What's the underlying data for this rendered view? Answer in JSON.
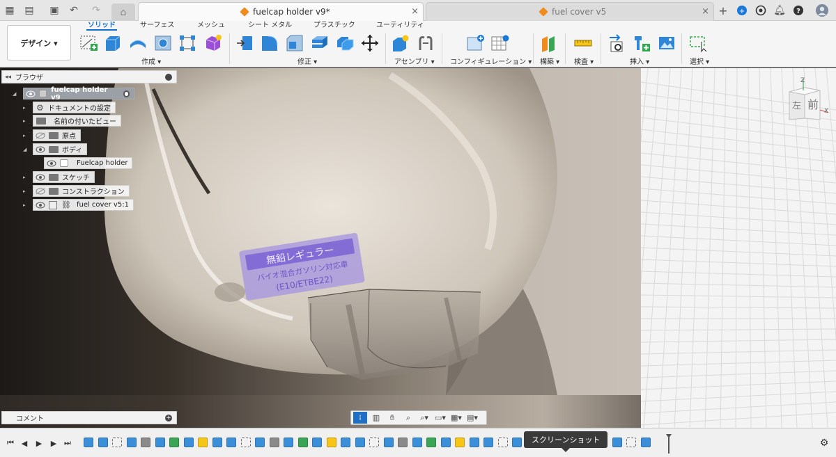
{
  "tabs": [
    {
      "label": "fuelcap holder v9*",
      "active": true
    },
    {
      "label": "fuel cover v5",
      "active": false
    }
  ],
  "tab_close_glyph": "×",
  "ribbon": {
    "design_label": "デザイン ▾",
    "tabs": [
      "ソリッド",
      "サーフェス",
      "メッシュ",
      "シート メタル",
      "プラスチック",
      "ユーティリティ"
    ],
    "groups": [
      "作成 ▾",
      "修正 ▾",
      "アセンブリ ▾",
      "コンフィギュレーション ▾",
      "構築 ▾",
      "検査 ▾",
      "挿入 ▾",
      "選択 ▾"
    ]
  },
  "browser": {
    "title": "ブラウザ",
    "root": "fuelcap holder v9",
    "items": [
      {
        "label": "ドキュメントの設定"
      },
      {
        "label": "名前の付いたビュー"
      },
      {
        "label": "原点"
      },
      {
        "label": "ボディ"
      },
      {
        "label": "Fuelcap holder"
      },
      {
        "label": "スケッチ"
      },
      {
        "label": "コンストラクション"
      },
      {
        "label": "fuel cover v5:1"
      }
    ]
  },
  "viewcube": {
    "face_front": "前",
    "face_left": "左",
    "axis_z": "Z",
    "axis_x": "X"
  },
  "decal": {
    "line1": "無鉛レギュラー",
    "line2": "バイオ混合ガソリン対応車",
    "line3": "(E10/ETBE22)"
  },
  "comments": {
    "label": "コメント"
  },
  "tooltip": "スクリーンショット",
  "colors": {
    "accent": "#0f6fc6",
    "tool_blue": "#3b8fd9",
    "tab_icon": "#f08c1e"
  }
}
